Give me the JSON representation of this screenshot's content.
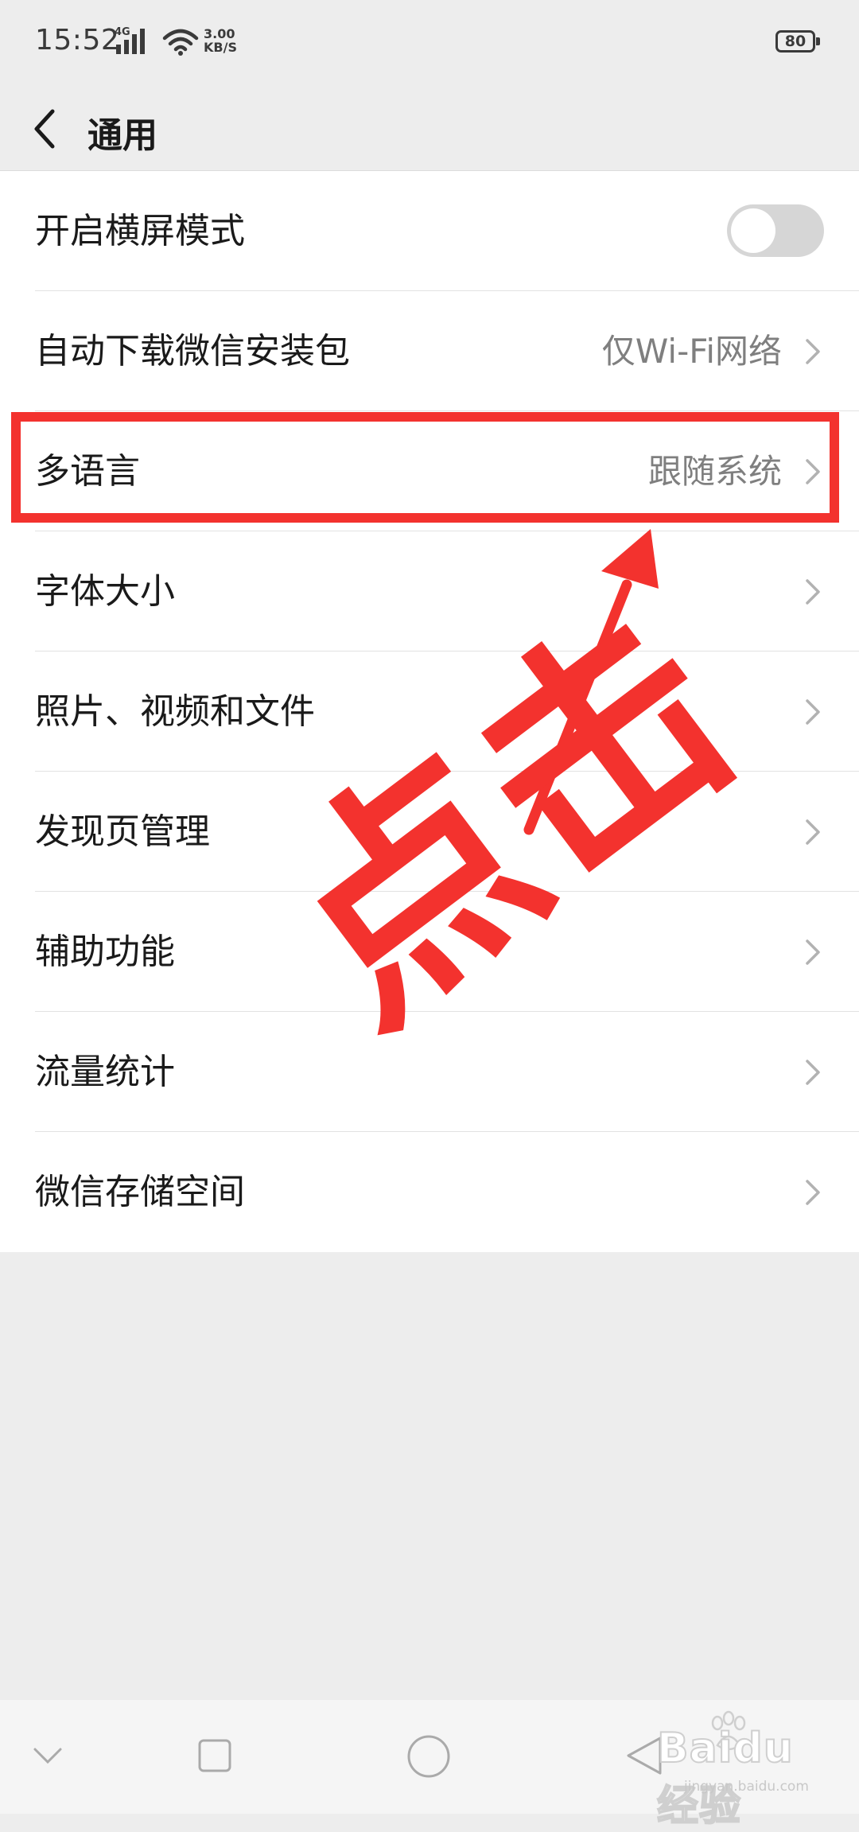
{
  "status_bar": {
    "time": "15:52",
    "network": "4G",
    "speed_value": "3.00",
    "speed_unit": "KB/S",
    "battery": "80"
  },
  "header": {
    "title": "通用"
  },
  "settings": {
    "items": [
      {
        "label": "开启横屏模式",
        "control": "toggle",
        "on": false
      },
      {
        "label": "自动下载微信安装包",
        "value": "仅Wi-Fi网络"
      },
      {
        "label": "多语言",
        "value": "跟随系统"
      },
      {
        "label": "字体大小"
      },
      {
        "label": "照片、视频和文件"
      },
      {
        "label": "发现页管理"
      },
      {
        "label": "辅助功能"
      },
      {
        "label": "流量统计"
      },
      {
        "label": "微信存储空间"
      }
    ]
  },
  "annotation": {
    "text": "点击",
    "color": "#f3322e"
  },
  "watermark": {
    "brand": "Baidu经验",
    "url": "jingyan.baidu.com"
  },
  "colors": {
    "background": "#ededed",
    "list_background": "#ffffff",
    "secondary_text": "#7f7f7f",
    "annotation_red": "#f3322e"
  }
}
